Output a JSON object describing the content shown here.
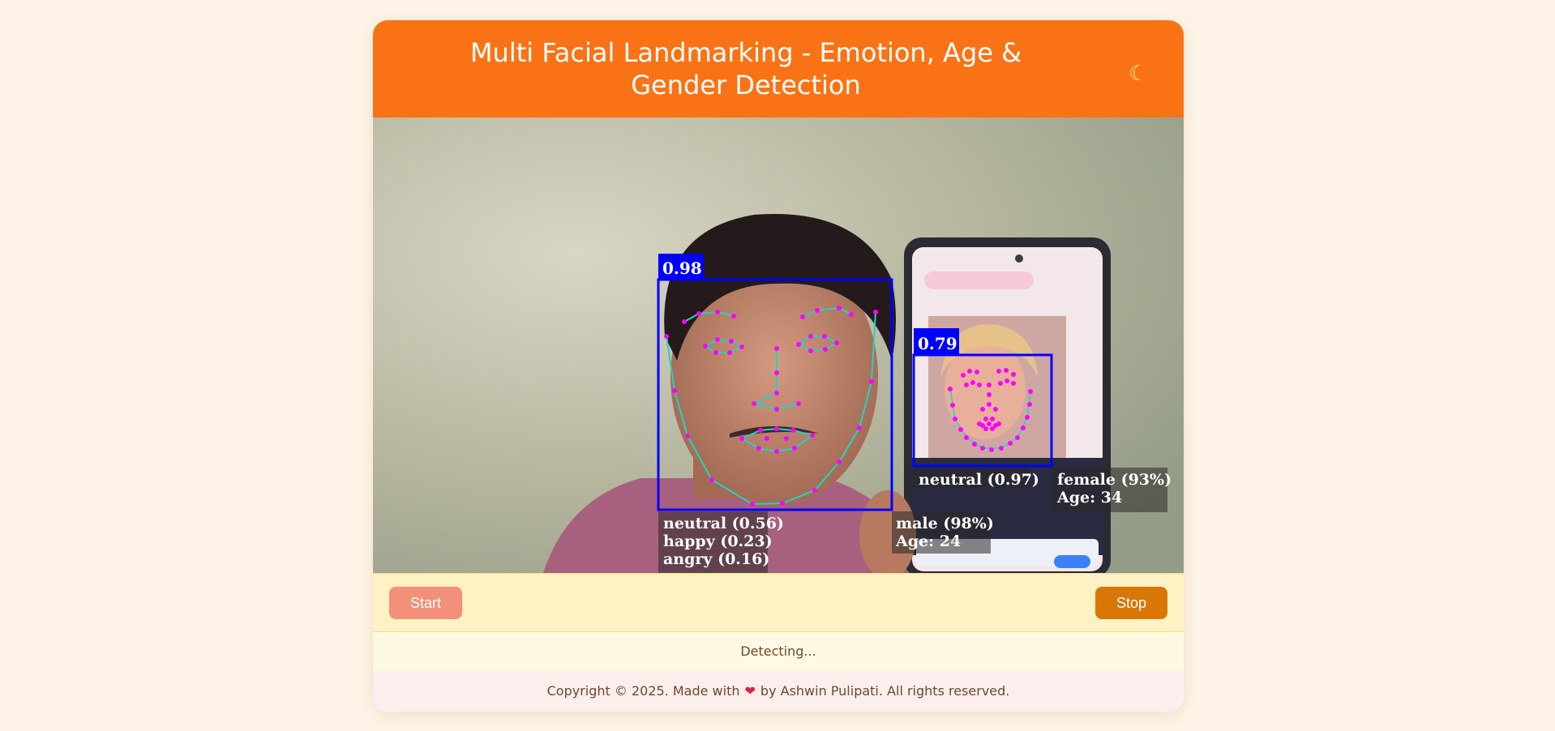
{
  "header": {
    "title": "Multi Facial Landmarking - Emotion, Age & Gender Detection",
    "theme_toggle_icon": "moon-icon"
  },
  "video": {
    "faces": [
      {
        "score": "0.98",
        "emotions": [
          "neutral (0.56)",
          "happy (0.23)",
          "angry (0.16)"
        ],
        "gender": "male (98%)",
        "age": "Age: 24"
      },
      {
        "score": "0.79",
        "emotions": [
          "neutral (0.97)"
        ],
        "gender": "female (93%)",
        "age": "Age: 34"
      }
    ]
  },
  "controls": {
    "start_label": "Start",
    "stop_label": "Stop"
  },
  "status": {
    "text": "Detecting..."
  },
  "footer": {
    "before": "Copyright © 2025. Made with",
    "heart_icon": "heart-icon",
    "after": "by Ashwin Pulipati. All rights reserved."
  },
  "colors": {
    "header": "#f97316",
    "start_button": "#f39079",
    "stop_button": "#d97706",
    "box": "#0000ff",
    "landmark": "#ff00ff",
    "mesh": "#22d3c5"
  }
}
